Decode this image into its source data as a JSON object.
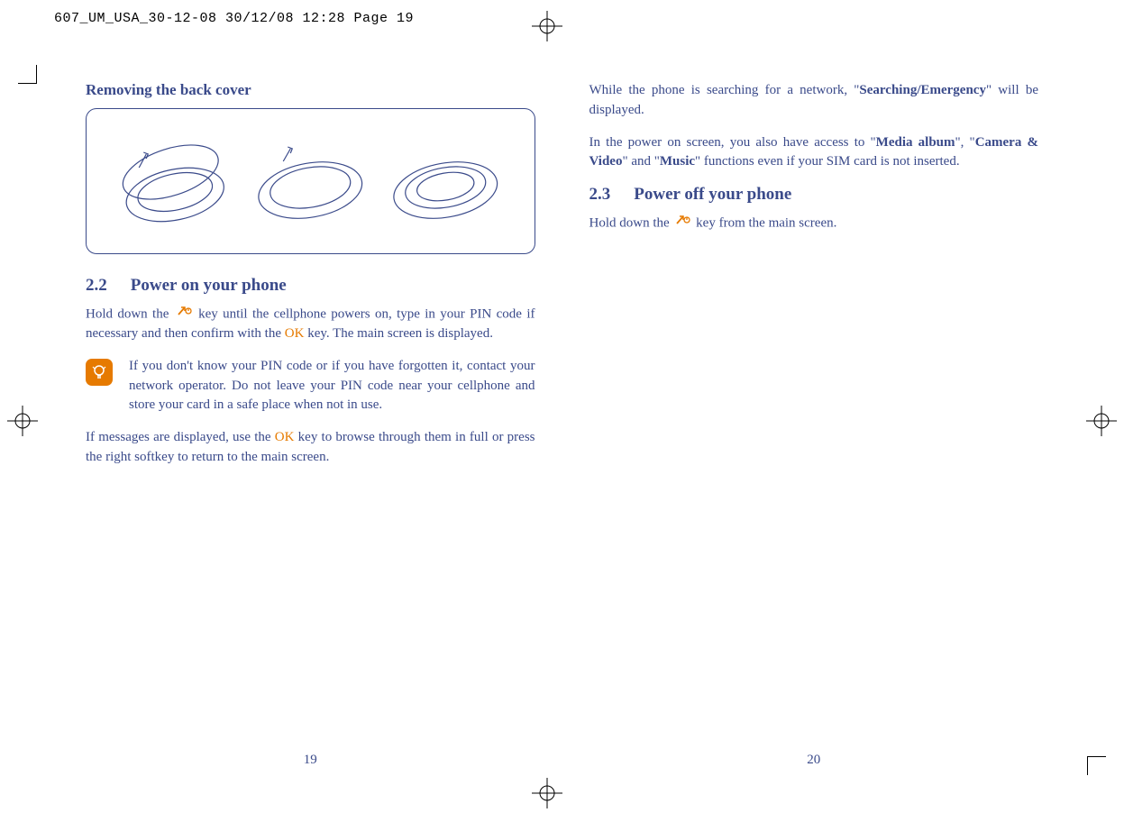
{
  "print_header": "607_UM_USA_30-12-08  30/12/08  12:28  Page 19",
  "left": {
    "title1": "Removing the back cover",
    "heading_num": "2.2",
    "heading_text": "Power on your phone",
    "para1_a": "Hold down the ",
    "para1_b": " key until the cellphone powers on, type in your PIN code if necessary and then confirm with the ",
    "para1_c": " key. The main screen is displayed.",
    "ok": "OK",
    "tip": "If you don't know your PIN code or if you have forgotten it, contact your network operator. Do not leave your PIN code near your cellphone and store your card in a safe place when not in use.",
    "para2_a": "If messages are displayed, use the ",
    "para2_b": " key to browse through them in full or press the right softkey to return to the main screen.",
    "page_num": "19"
  },
  "right": {
    "para1_a": "While the phone is searching for a network, \"",
    "para1_bold1": "Searching/Emergency",
    "para1_b": "\" will be displayed.",
    "para2_a": "In the power on screen, you also have access to \"",
    "para2_bold1": "Media album",
    "para2_b": "\", \"",
    "para2_bold2": "Camera & Video",
    "para2_c": "\" and \"",
    "para2_bold3": "Music",
    "para2_d": "\" functions even if your SIM card is not inserted.",
    "heading_num": "2.3",
    "heading_text": "Power off your phone",
    "para3_a": "Hold down the ",
    "para3_b": " key from the main screen.",
    "page_num": "20"
  }
}
